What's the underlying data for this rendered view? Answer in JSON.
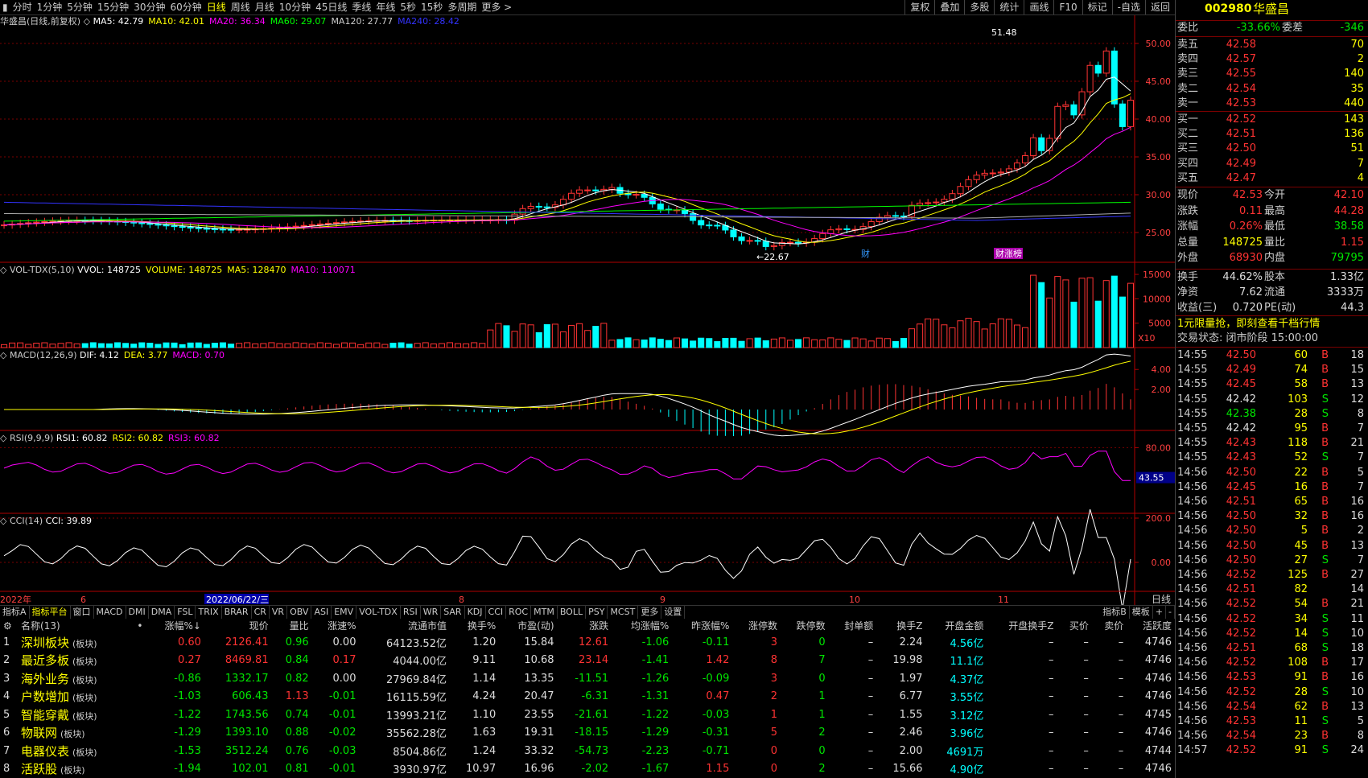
{
  "toolbar": {
    "periods": [
      "分时",
      "1分钟",
      "5分钟",
      "15分钟",
      "30分钟",
      "60分钟",
      "日线",
      "周线",
      "月线",
      "10分钟",
      "45日线",
      "季线",
      "年线",
      "5秒",
      "15秒",
      "多周期",
      "更多 >"
    ],
    "active": "日线",
    "right": [
      "复权",
      "叠加",
      "多股",
      "统计",
      "画线",
      "F10",
      "标记",
      "-自选",
      "返回"
    ]
  },
  "main_chart": {
    "title": "华盛昌(日线,前复权)",
    "ma": [
      {
        "label": "MA5: 42.79",
        "color": "#ffffff"
      },
      {
        "label": "MA10: 42.01",
        "color": "#ffff00"
      },
      {
        "label": "MA20: 36.34",
        "color": "#ff00ff"
      },
      {
        "label": "MA60: 29.07",
        "color": "#00ff00"
      },
      {
        "label": "MA120: 27.77",
        "color": "#cccccc"
      },
      {
        "label": "MA240: 28.42",
        "color": "#3333ff"
      }
    ],
    "yticks": [
      "50.00",
      "45.00",
      "40.00",
      "35.00",
      "30.00",
      "25.00"
    ],
    "high_label": "51.48",
    "low_label": "22.67",
    "markers": [
      "财",
      "财涨榜"
    ]
  },
  "vol": {
    "title": "VOL-TDX(5,10)",
    "items": [
      {
        "label": "VVOL: 148725",
        "color": "#ffffff"
      },
      {
        "label": "VOLUME: 148725",
        "color": "#ffff00"
      },
      {
        "label": "MA5: 128470",
        "color": "#ffff00"
      },
      {
        "label": "MA10: 110071",
        "color": "#ff00ff"
      }
    ],
    "yticks": [
      "15000",
      "10000",
      "5000"
    ],
    "unit": "X10"
  },
  "macd": {
    "title": "MACD(12,26,9)",
    "items": [
      {
        "label": "DIF: 4.12",
        "color": "#ffffff"
      },
      {
        "label": "DEA: 3.77",
        "color": "#ffff00"
      },
      {
        "label": "MACD: 0.70",
        "color": "#ff00ff"
      }
    ],
    "yticks": [
      "4.00",
      "2.00"
    ]
  },
  "rsi": {
    "title": "RSI(9,9,9)",
    "items": [
      {
        "label": "RSI1: 60.82",
        "color": "#ffffff"
      },
      {
        "label": "RSI2: 60.82",
        "color": "#ffff00"
      },
      {
        "label": "RSI3: 60.82",
        "color": "#ff00ff"
      }
    ],
    "yticks": [
      "80.00"
    ],
    "marker": "43.55"
  },
  "cci": {
    "title": "CCI(14)",
    "items": [
      {
        "label": "CCI: 39.89",
        "color": "#ffffff"
      }
    ],
    "yticks": [
      "200.0",
      "0.00"
    ]
  },
  "xaxis": {
    "labels": [
      "2022年",
      "6",
      "2022/06/22/三",
      "8",
      "9",
      "10",
      "11"
    ],
    "period": "日线"
  },
  "tabs": {
    "items": [
      "指标A",
      "指标平台",
      "窗口",
      "MACD",
      "DMI",
      "DMA",
      "FSL",
      "TRIX",
      "BRAR",
      "CR",
      "VR",
      "OBV",
      "ASI",
      "EMV",
      "VOL-TDX",
      "RSI",
      "WR",
      "SAR",
      "KDJ",
      "CCI",
      "ROC",
      "MTM",
      "BOLL",
      "PSY",
      "MCST",
      "更多",
      "设置"
    ],
    "right": [
      "指标B",
      "模板",
      "+",
      "-"
    ]
  },
  "table": {
    "headers": [
      "名称(13)",
      "•",
      "涨幅%↓",
      "现价",
      "量比",
      "涨速%",
      "流通市值",
      "换手%",
      "市盈(动)",
      "涨跌",
      "均涨幅%",
      "昨涨幅%",
      "涨停数",
      "跌停数",
      "封单额",
      "换手Z",
      "开盘金额",
      "开盘换手Z",
      "买价",
      "卖价",
      "活跃度"
    ],
    "rows": [
      {
        "no": "1",
        "name": "深圳板块",
        "tag": "(板块)",
        "chg": "0.60",
        "price": "2126.41",
        "vr": "0.96",
        "spd": "0.00",
        "mcap": "64123.52亿",
        "turn": "1.20",
        "pe": "15.84",
        "diff": "12.61",
        "avg": "-1.06",
        "yest": "-0.11",
        "up": "3",
        "down": "0",
        "seal": "–",
        "tz": "2.24",
        "open": "4.56亿",
        "otz": "–",
        "buy": "–",
        "sell": "–",
        "act": "4746"
      },
      {
        "no": "2",
        "name": "最近多板",
        "tag": "(板块)",
        "chg": "0.27",
        "price": "8469.81",
        "vr": "0.84",
        "spd": "0.17",
        "mcap": "4044.00亿",
        "turn": "9.11",
        "pe": "10.68",
        "diff": "23.14",
        "avg": "-1.41",
        "yest": "1.42",
        "up": "8",
        "down": "7",
        "seal": "–",
        "tz": "19.98",
        "open": "11.1亿",
        "otz": "–",
        "buy": "–",
        "sell": "–",
        "act": "4746"
      },
      {
        "no": "3",
        "name": "海外业务",
        "tag": "(板块)",
        "chg": "-0.86",
        "price": "1332.17",
        "vr": "0.82",
        "spd": "0.00",
        "mcap": "27969.84亿",
        "turn": "1.14",
        "pe": "13.35",
        "diff": "-11.51",
        "avg": "-1.26",
        "yest": "-0.09",
        "up": "3",
        "down": "0",
        "seal": "–",
        "tz": "1.97",
        "open": "4.37亿",
        "otz": "–",
        "buy": "–",
        "sell": "–",
        "act": "4746"
      },
      {
        "no": "4",
        "name": "户数增加",
        "tag": "(板块)",
        "chg": "-1.03",
        "price": "606.43",
        "vr": "1.13",
        "spd": "-0.01",
        "mcap": "16115.59亿",
        "turn": "4.24",
        "pe": "20.47",
        "diff": "-6.31",
        "avg": "-1.31",
        "yest": "0.47",
        "up": "2",
        "down": "1",
        "seal": "–",
        "tz": "6.77",
        "open": "3.55亿",
        "otz": "–",
        "buy": "–",
        "sell": "–",
        "act": "4746"
      },
      {
        "no": "5",
        "name": "智能穿戴",
        "tag": "(板块)",
        "chg": "-1.22",
        "price": "1743.56",
        "vr": "0.74",
        "spd": "-0.01",
        "mcap": "13993.21亿",
        "turn": "1.10",
        "pe": "23.55",
        "diff": "-21.61",
        "avg": "-1.22",
        "yest": "-0.03",
        "up": "1",
        "down": "1",
        "seal": "–",
        "tz": "1.55",
        "open": "3.12亿",
        "otz": "–",
        "buy": "–",
        "sell": "–",
        "act": "4745"
      },
      {
        "no": "6",
        "name": "物联网",
        "tag": "(板块)",
        "chg": "-1.29",
        "price": "1393.10",
        "vr": "0.88",
        "spd": "-0.02",
        "mcap": "35562.28亿",
        "turn": "1.63",
        "pe": "19.31",
        "diff": "-18.15",
        "avg": "-1.29",
        "yest": "-0.31",
        "up": "5",
        "down": "2",
        "seal": "–",
        "tz": "2.46",
        "open": "3.96亿",
        "otz": "–",
        "buy": "–",
        "sell": "–",
        "act": "4746"
      },
      {
        "no": "7",
        "name": "电器仪表",
        "tag": "(板块)",
        "chg": "-1.53",
        "price": "3512.24",
        "vr": "0.76",
        "spd": "-0.03",
        "mcap": "8504.86亿",
        "turn": "1.24",
        "pe": "33.32",
        "diff": "-54.73",
        "avg": "-2.23",
        "yest": "-0.71",
        "up": "0",
        "down": "0",
        "seal": "–",
        "tz": "2.00",
        "open": "4691万",
        "otz": "–",
        "buy": "–",
        "sell": "–",
        "act": "4744"
      },
      {
        "no": "8",
        "name": "活跃股",
        "tag": "(板块)",
        "chg": "-1.94",
        "price": "102.01",
        "vr": "0.81",
        "spd": "-0.01",
        "mcap": "3930.97亿",
        "turn": "10.97",
        "pe": "16.96",
        "diff": "-2.02",
        "avg": "-1.67",
        "yest": "1.15",
        "up": "0",
        "down": "2",
        "seal": "–",
        "tz": "15.66",
        "open": "4.90亿",
        "otz": "–",
        "buy": "–",
        "sell": "–",
        "act": "4746"
      }
    ]
  },
  "quote": {
    "code": "002980",
    "name": "华盛昌",
    "wb": {
      "label": "委比",
      "value": "-33.66%",
      "label2": "委差",
      "value2": "-346"
    },
    "asks": [
      {
        "label": "卖五",
        "price": "42.58",
        "vol": "70"
      },
      {
        "label": "卖四",
        "price": "42.57",
        "vol": "2"
      },
      {
        "label": "卖三",
        "price": "42.55",
        "vol": "140"
      },
      {
        "label": "卖二",
        "price": "42.54",
        "vol": "35"
      },
      {
        "label": "卖一",
        "price": "42.53",
        "vol": "440"
      }
    ],
    "bids": [
      {
        "label": "买一",
        "price": "42.52",
        "vol": "143"
      },
      {
        "label": "买二",
        "price": "42.51",
        "vol": "136"
      },
      {
        "label": "买三",
        "price": "42.50",
        "vol": "51"
      },
      {
        "label": "买四",
        "price": "42.49",
        "vol": "7"
      },
      {
        "label": "买五",
        "price": "42.47",
        "vol": "4"
      }
    ],
    "stats": [
      {
        "l1": "现价",
        "v1": "42.53",
        "c1": "red",
        "l2": "今开",
        "v2": "42.10",
        "c2": "red"
      },
      {
        "l1": "涨跌",
        "v1": "0.11",
        "c1": "red",
        "l2": "最高",
        "v2": "44.28",
        "c2": "red"
      },
      {
        "l1": "涨幅",
        "v1": "0.26%",
        "c1": "red",
        "l2": "最低",
        "v2": "38.58",
        "c2": "grn"
      },
      {
        "l1": "总量",
        "v1": "148725",
        "c1": "yel",
        "l2": "量比",
        "v2": "1.15",
        "c2": "red"
      },
      {
        "l1": "外盘",
        "v1": "68930",
        "c1": "red",
        "l2": "内盘",
        "v2": "79795",
        "c2": "grn"
      }
    ],
    "stats2": [
      {
        "l1": "换手",
        "v1": "44.62%",
        "l2": "股本",
        "v2": "1.33亿"
      },
      {
        "l1": "净资",
        "v1": "7.62",
        "l2": "流通",
        "v2": "3333万"
      },
      {
        "l1": "收益(三)",
        "v1": "0.720",
        "l2": "PE(动)",
        "v2": "44.3"
      }
    ],
    "promo": "1元限量抢，即刻查看千档行情",
    "status": "交易状态: 闭市阶段 15:00:00",
    "ticks": [
      {
        "t": "14:55",
        "p": "42.50",
        "c": "red",
        "v": "60",
        "bs": "B",
        "n": "18"
      },
      {
        "t": "14:55",
        "p": "42.49",
        "c": "red",
        "v": "74",
        "bs": "B",
        "n": "15"
      },
      {
        "t": "14:55",
        "p": "42.45",
        "c": "red",
        "v": "58",
        "bs": "B",
        "n": "13"
      },
      {
        "t": "14:55",
        "p": "42.42",
        "c": "wht",
        "v": "103",
        "bs": "S",
        "n": "12"
      },
      {
        "t": "14:55",
        "p": "42.38",
        "c": "grn",
        "v": "28",
        "bs": "S",
        "n": "8"
      },
      {
        "t": "14:55",
        "p": "42.42",
        "c": "wht",
        "v": "95",
        "bs": "B",
        "n": "7"
      },
      {
        "t": "14:55",
        "p": "42.43",
        "c": "red",
        "v": "118",
        "bs": "B",
        "n": "21"
      },
      {
        "t": "14:55",
        "p": "42.43",
        "c": "red",
        "v": "52",
        "bs": "S",
        "n": "7"
      },
      {
        "t": "14:56",
        "p": "42.50",
        "c": "red",
        "v": "22",
        "bs": "B",
        "n": "5"
      },
      {
        "t": "14:56",
        "p": "42.45",
        "c": "red",
        "v": "16",
        "bs": "B",
        "n": "7"
      },
      {
        "t": "14:56",
        "p": "42.51",
        "c": "red",
        "v": "65",
        "bs": "B",
        "n": "16"
      },
      {
        "t": "14:56",
        "p": "42.50",
        "c": "red",
        "v": "32",
        "bs": "B",
        "n": "16"
      },
      {
        "t": "14:56",
        "p": "42.50",
        "c": "red",
        "v": "5",
        "bs": "B",
        "n": "2"
      },
      {
        "t": "14:56",
        "p": "42.50",
        "c": "red",
        "v": "45",
        "bs": "B",
        "n": "13"
      },
      {
        "t": "14:56",
        "p": "42.50",
        "c": "red",
        "v": "27",
        "bs": "S",
        "n": "7"
      },
      {
        "t": "14:56",
        "p": "42.52",
        "c": "red",
        "v": "125",
        "bs": "B",
        "n": "27"
      },
      {
        "t": "14:56",
        "p": "42.51",
        "c": "red",
        "v": "82",
        "bs": "",
        "n": "14"
      },
      {
        "t": "14:56",
        "p": "42.52",
        "c": "red",
        "v": "54",
        "bs": "B",
        "n": "21"
      },
      {
        "t": "14:56",
        "p": "42.52",
        "c": "red",
        "v": "34",
        "bs": "S",
        "n": "11"
      },
      {
        "t": "14:56",
        "p": "42.52",
        "c": "red",
        "v": "14",
        "bs": "S",
        "n": "10"
      },
      {
        "t": "14:56",
        "p": "42.51",
        "c": "red",
        "v": "68",
        "bs": "S",
        "n": "18"
      },
      {
        "t": "14:56",
        "p": "42.52",
        "c": "red",
        "v": "108",
        "bs": "B",
        "n": "17"
      },
      {
        "t": "14:56",
        "p": "42.53",
        "c": "red",
        "v": "91",
        "bs": "B",
        "n": "16"
      },
      {
        "t": "14:56",
        "p": "42.52",
        "c": "red",
        "v": "28",
        "bs": "S",
        "n": "10"
      },
      {
        "t": "14:56",
        "p": "42.54",
        "c": "red",
        "v": "62",
        "bs": "B",
        "n": "13"
      },
      {
        "t": "14:56",
        "p": "42.53",
        "c": "red",
        "v": "11",
        "bs": "S",
        "n": "5"
      },
      {
        "t": "14:56",
        "p": "42.54",
        "c": "red",
        "v": "23",
        "bs": "B",
        "n": "8"
      },
      {
        "t": "14:57",
        "p": "42.52",
        "c": "red",
        "v": "91",
        "bs": "S",
        "n": "24"
      }
    ]
  },
  "colors": {
    "up": "#ff3333",
    "down": "#00e600",
    "grid": "#7a0000",
    "axis": "#b00000",
    "cyan": "#00ffff"
  }
}
